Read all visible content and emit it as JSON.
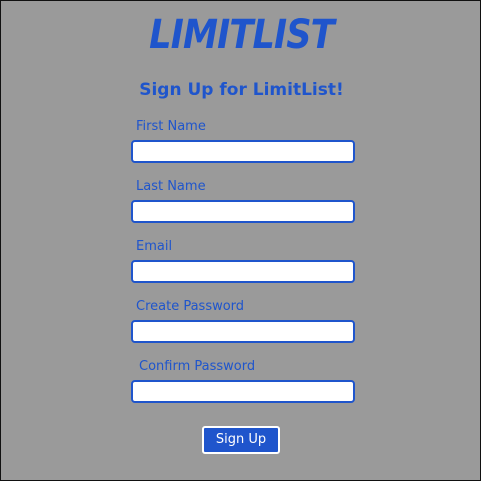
{
  "brand": {
    "logo_text": "LIMITLIST",
    "accent_color": "#1f55cc",
    "background_color": "#9a9a9a"
  },
  "form": {
    "heading": "Sign Up for LimitList!",
    "fields": [
      {
        "label": "First Name",
        "value": "",
        "placeholder": ""
      },
      {
        "label": "Last Name",
        "value": "",
        "placeholder": ""
      },
      {
        "label": "Email",
        "value": "",
        "placeholder": ""
      },
      {
        "label": "Create Password",
        "value": "",
        "placeholder": ""
      },
      {
        "label": "Confirm Password",
        "value": "",
        "placeholder": ""
      }
    ],
    "submit_label": "Sign Up"
  }
}
